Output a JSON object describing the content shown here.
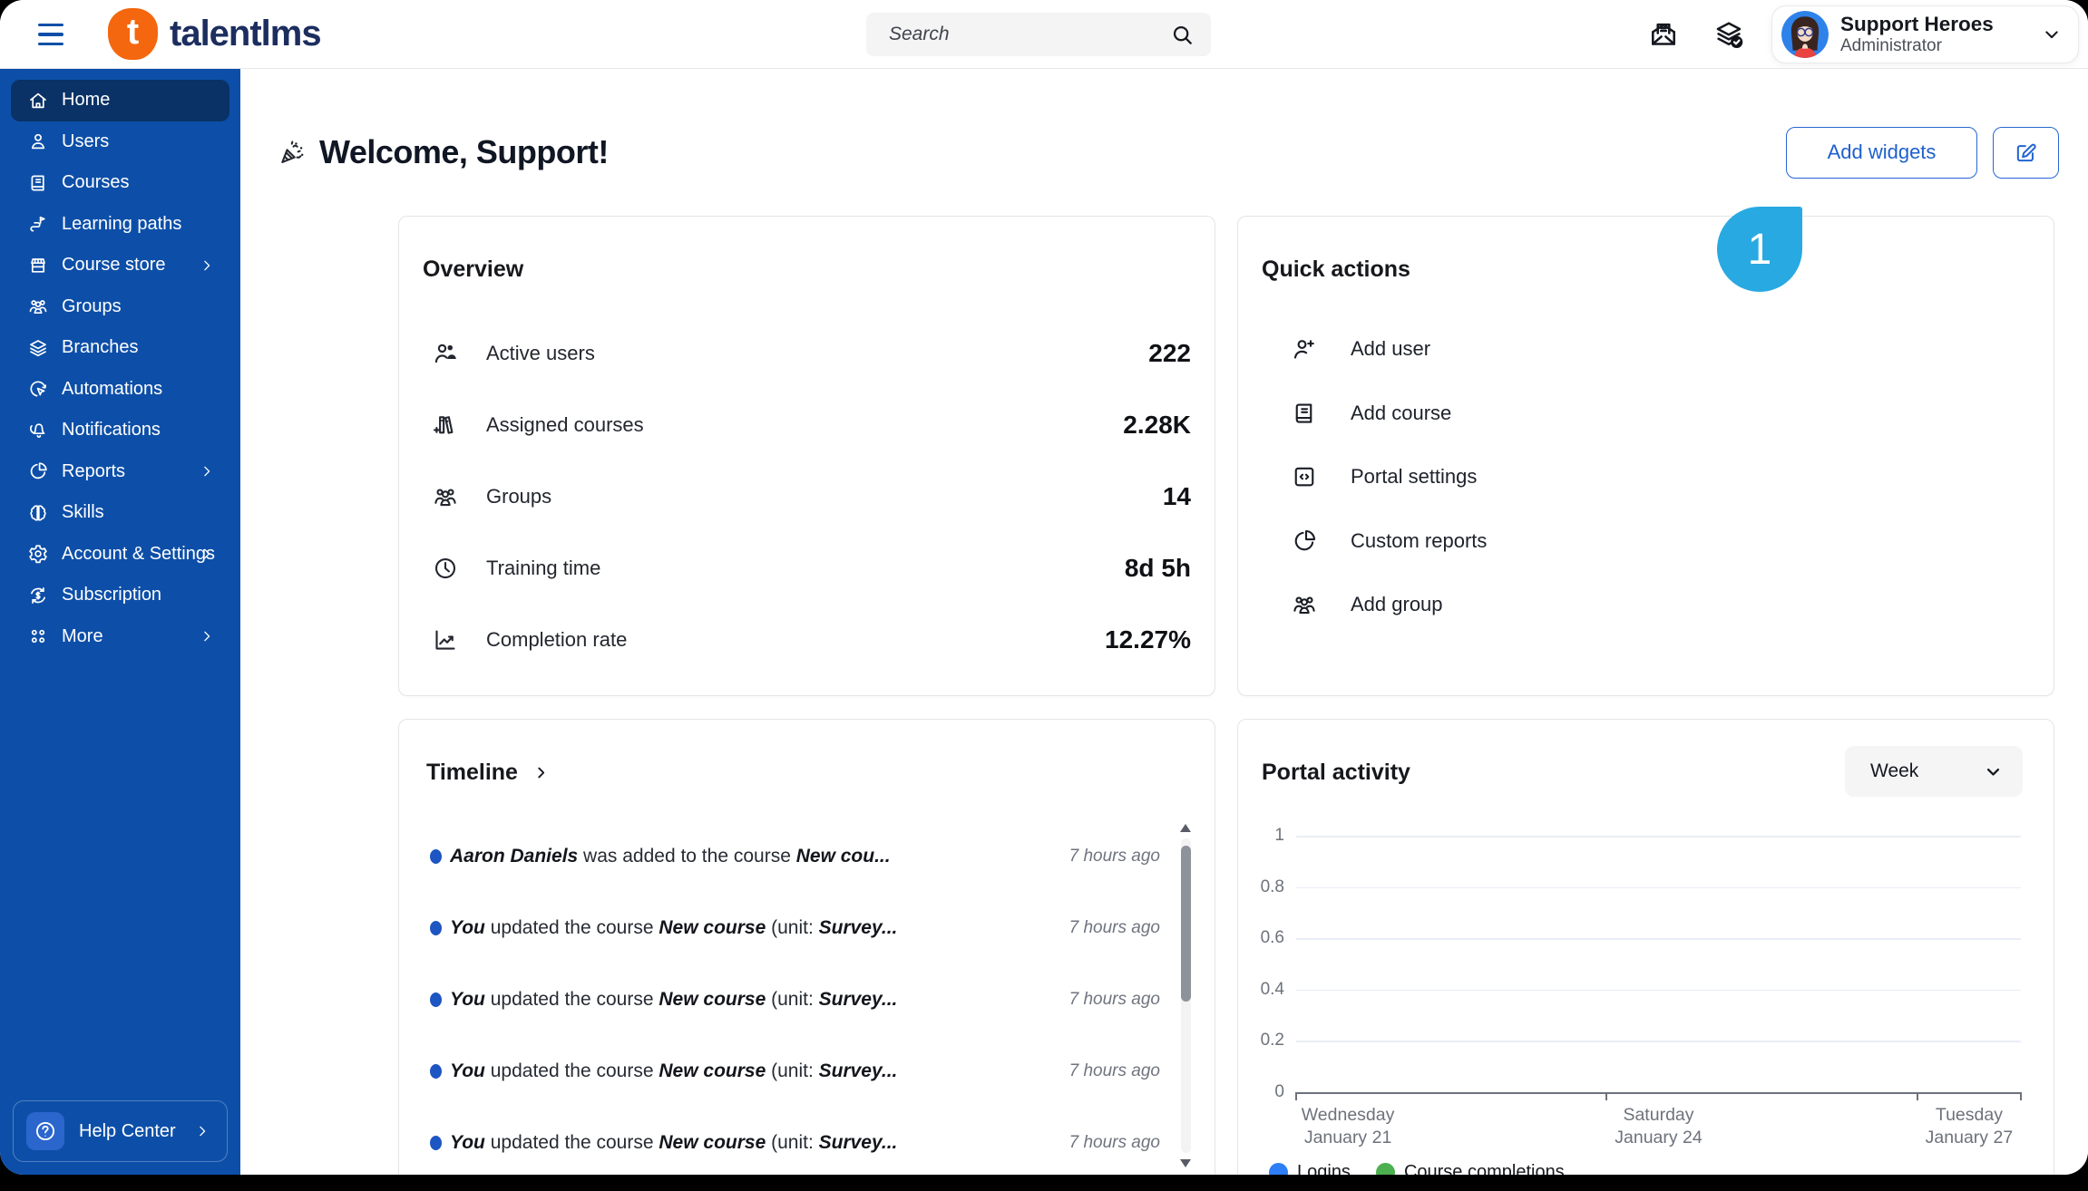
{
  "colors": {
    "sidebar_blue": "#0d4fa8",
    "sidebar_active": "#0a3266",
    "accent_blue": "#1e5fce",
    "annotation_blue": "#29a9e1",
    "logo_orange": "#f4670e",
    "logo_navy": "#1c2d5f",
    "timeline_dot": "#1d55c2",
    "legend_logins": "#2d7ef7",
    "legend_completions": "#4caf50"
  },
  "header": {
    "logo_letter": "t",
    "logo_text": "talentlms",
    "search": {
      "placeholder": "Search"
    },
    "icons": [
      "inbox-icon",
      "course-stack-icon"
    ],
    "user": {
      "name": "Support Heroes",
      "role": "Administrator"
    }
  },
  "sidebar": {
    "items": [
      {
        "label": "Home",
        "icon": "home",
        "active": true,
        "has_submenu": false
      },
      {
        "label": "Users",
        "icon": "users",
        "active": false,
        "has_submenu": false
      },
      {
        "label": "Courses",
        "icon": "courses",
        "active": false,
        "has_submenu": false
      },
      {
        "label": "Learning paths",
        "icon": "learning-paths",
        "active": false,
        "has_submenu": false
      },
      {
        "label": "Course store",
        "icon": "course-store",
        "active": false,
        "has_submenu": true
      },
      {
        "label": "Groups",
        "icon": "groups",
        "active": false,
        "has_submenu": false
      },
      {
        "label": "Branches",
        "icon": "branches",
        "active": false,
        "has_submenu": false
      },
      {
        "label": "Automations",
        "icon": "automations",
        "active": false,
        "has_submenu": false
      },
      {
        "label": "Notifications",
        "icon": "notifications",
        "active": false,
        "has_submenu": false
      },
      {
        "label": "Reports",
        "icon": "reports",
        "active": false,
        "has_submenu": true
      },
      {
        "label": "Skills",
        "icon": "skills",
        "active": false,
        "has_submenu": false
      },
      {
        "label": "Account & Settings",
        "icon": "settings",
        "active": false,
        "has_submenu": true
      },
      {
        "label": "Subscription",
        "icon": "subscription",
        "active": false,
        "has_submenu": false
      },
      {
        "label": "More",
        "icon": "more",
        "active": false,
        "has_submenu": true
      }
    ],
    "help": {
      "label": "Help Center",
      "icon": "help"
    }
  },
  "main": {
    "welcome_title": "Welcome, Support!",
    "add_widgets_label": "Add widgets",
    "annotation_step": "1"
  },
  "overview": {
    "title": "Overview",
    "stats": [
      {
        "label": "Active users",
        "value": "222",
        "icon": "active-users"
      },
      {
        "label": "Assigned courses",
        "value": "2.28K",
        "icon": "assigned-courses"
      },
      {
        "label": "Groups",
        "value": "14",
        "icon": "groups"
      },
      {
        "label": "Training time",
        "value": "8d 5h",
        "icon": "clock"
      },
      {
        "label": "Completion rate",
        "value": "12.27%",
        "icon": "completion"
      }
    ]
  },
  "quick_actions": {
    "title": "Quick actions",
    "actions": [
      {
        "label": "Add user",
        "icon": "add-user"
      },
      {
        "label": "Add course",
        "icon": "add-course"
      },
      {
        "label": "Portal settings",
        "icon": "portal-settings"
      },
      {
        "label": "Custom reports",
        "icon": "custom-reports"
      },
      {
        "label": "Add group",
        "icon": "add-group"
      }
    ]
  },
  "timeline": {
    "title": "Timeline",
    "items": [
      {
        "parts": [
          {
            "t": "Aaron Daniels",
            "b": true
          },
          {
            "t": " was added to the course "
          },
          {
            "t": "New cou...",
            "b": true
          }
        ],
        "time": "7 hours ago"
      },
      {
        "parts": [
          {
            "t": "You",
            "b": true
          },
          {
            "t": " updated the course "
          },
          {
            "t": "New course",
            "b": true
          },
          {
            "t": " (unit: "
          },
          {
            "t": "Survey...",
            "b": true
          }
        ],
        "time": "7 hours ago"
      },
      {
        "parts": [
          {
            "t": "You",
            "b": true
          },
          {
            "t": " updated the course "
          },
          {
            "t": "New course",
            "b": true
          },
          {
            "t": " (unit: "
          },
          {
            "t": "Survey...",
            "b": true
          }
        ],
        "time": "7 hours ago"
      },
      {
        "parts": [
          {
            "t": "You",
            "b": true
          },
          {
            "t": " updated the course "
          },
          {
            "t": "New course",
            "b": true
          },
          {
            "t": " (unit: "
          },
          {
            "t": "Survey...",
            "b": true
          }
        ],
        "time": "7 hours ago"
      },
      {
        "parts": [
          {
            "t": "You",
            "b": true
          },
          {
            "t": " updated the course "
          },
          {
            "t": "New course",
            "b": true
          },
          {
            "t": " (unit: "
          },
          {
            "t": "Survey...",
            "b": true
          }
        ],
        "time": "7 hours ago"
      }
    ]
  },
  "portal_activity": {
    "title": "Portal activity",
    "period_selector": "Week"
  },
  "chart_data": {
    "type": "line",
    "title": "Portal activity",
    "period": "Week",
    "ylim": [
      0,
      1
    ],
    "y_ticks": [
      0,
      0.2,
      0.4,
      0.6,
      0.8,
      1
    ],
    "grid": true,
    "span_days": 7,
    "tick_days": [
      0,
      3,
      6,
      7
    ],
    "x_tick_labels": [
      {
        "day": "Wednesday",
        "date": "January 21",
        "at_day": 0
      },
      {
        "day": "Saturday",
        "date": "January 24",
        "at_day": 3
      },
      {
        "day": "Tuesday",
        "date": "January 27",
        "at_day": 6
      }
    ],
    "legend_position": "bottom-left",
    "series": [
      {
        "name": "Logins",
        "color": "#2d7ef7",
        "values": []
      },
      {
        "name": "Course completions",
        "color": "#4caf50",
        "values": []
      }
    ]
  }
}
